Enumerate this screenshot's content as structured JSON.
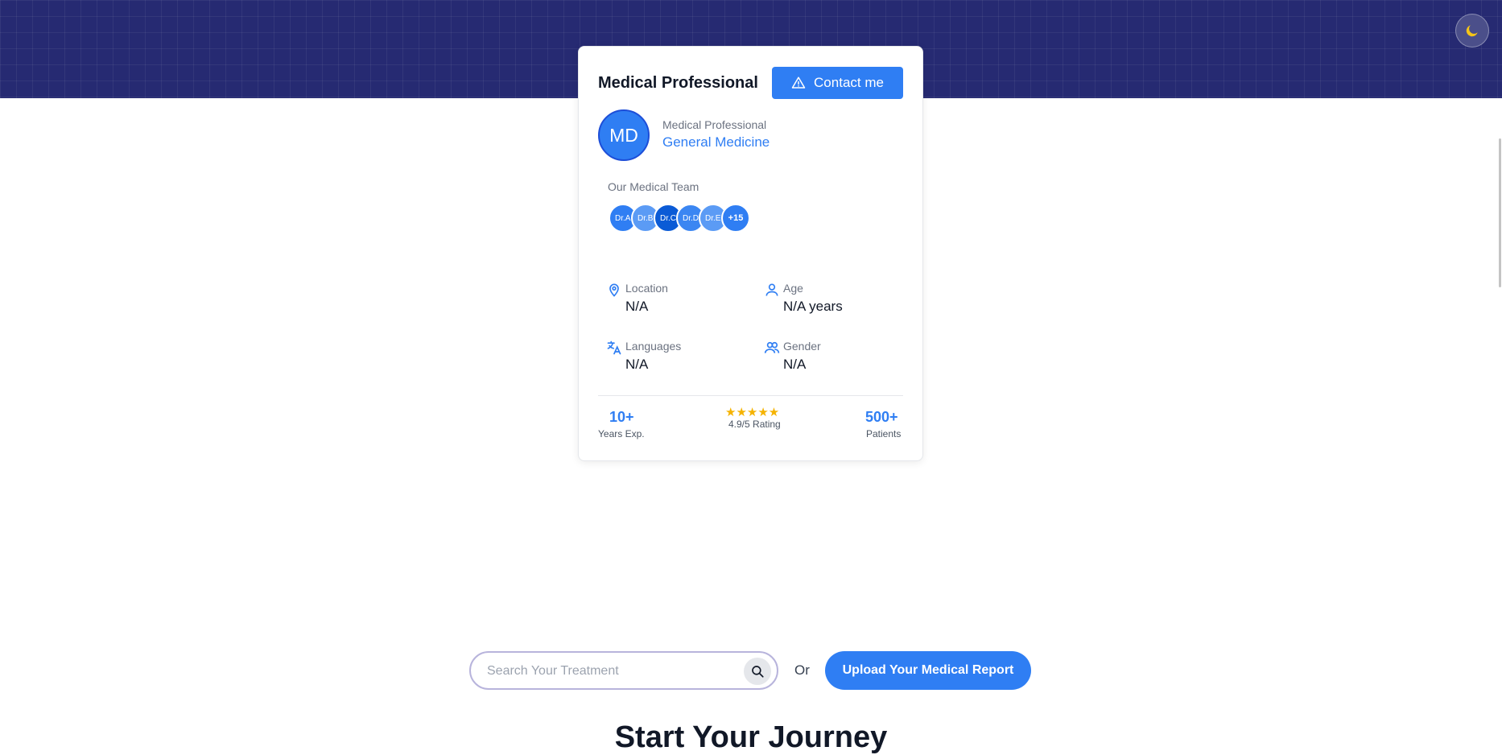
{
  "hero": {
    "bg_color": "#262a72"
  },
  "theme_toggle": {
    "icon": "moon-icon",
    "color": "#f5c518"
  },
  "card": {
    "title": "Medical Professional",
    "contact_button": {
      "label": "Contact me",
      "icon": "alert-triangle-icon"
    },
    "avatar_initials": "MD",
    "role": "Medical Professional",
    "specialty": "General Medicine",
    "team": {
      "label": "Our Medical Team",
      "members": [
        "Dr.A",
        "Dr.B",
        "Dr.C",
        "Dr.D",
        "Dr.E"
      ],
      "more": "+15"
    },
    "info": {
      "location": {
        "label": "Location",
        "value": "N/A",
        "icon": "map-pin-icon"
      },
      "age": {
        "label": "Age",
        "value": "N/A years",
        "icon": "user-icon"
      },
      "languages": {
        "label": "Languages",
        "value": "N/A",
        "icon": "translate-icon"
      },
      "gender": {
        "label": "Gender",
        "value": "N/A",
        "icon": "users-icon"
      }
    },
    "stats": {
      "experience": {
        "value": "10+",
        "label": "Years Exp."
      },
      "rating": {
        "stars": "★★★★★",
        "label": "4.9/5 Rating"
      },
      "patients": {
        "value": "500+",
        "label": "Patients"
      }
    }
  },
  "search": {
    "placeholder": "Search Your Treatment",
    "icon": "search-icon"
  },
  "or_text": "Or",
  "upload_button": {
    "label": "Upload Your Medical Report"
  },
  "journey_title": "Start Your Journey",
  "colors": {
    "accent": "#2f7ef3",
    "star": "#f5b301"
  }
}
